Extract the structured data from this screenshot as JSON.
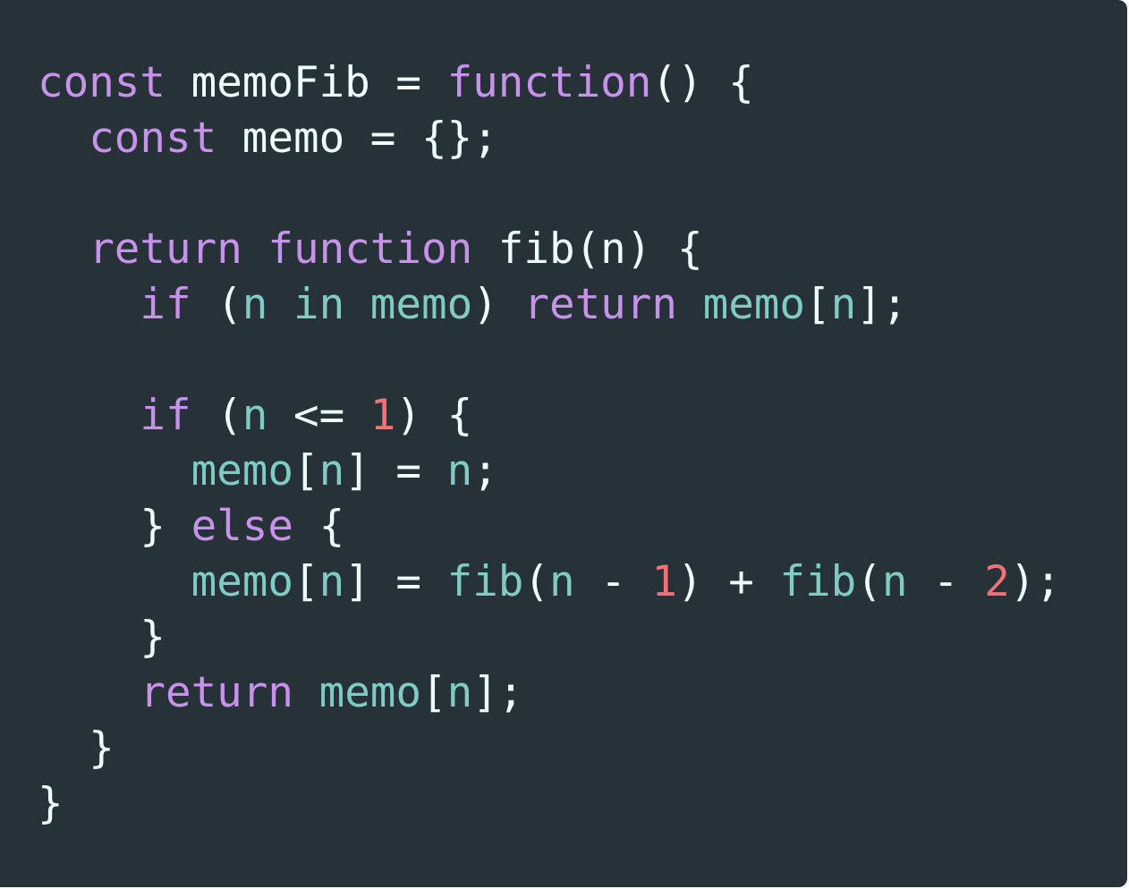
{
  "colors": {
    "background": "#263238",
    "keyword": "#c792ea",
    "identifier": "#80cbc4",
    "number": "#f07178",
    "plain": "#eeffff"
  },
  "code_lines": [
    [
      {
        "text": "const",
        "kind": "keyword"
      },
      {
        "text": " memoFib = ",
        "kind": "plain"
      },
      {
        "text": "function",
        "kind": "keyword"
      },
      {
        "text": "() {",
        "kind": "plain"
      }
    ],
    [
      {
        "text": "  ",
        "kind": "plain"
      },
      {
        "text": "const",
        "kind": "keyword"
      },
      {
        "text": " memo = {};",
        "kind": "plain"
      }
    ],
    [],
    [
      {
        "text": "  ",
        "kind": "plain"
      },
      {
        "text": "return",
        "kind": "keyword"
      },
      {
        "text": " ",
        "kind": "plain"
      },
      {
        "text": "function",
        "kind": "keyword"
      },
      {
        "text": " fib(n) {",
        "kind": "plain"
      }
    ],
    [
      {
        "text": "    ",
        "kind": "plain"
      },
      {
        "text": "if",
        "kind": "keyword"
      },
      {
        "text": " (",
        "kind": "plain"
      },
      {
        "text": "n in memo",
        "kind": "identifier"
      },
      {
        "text": ") ",
        "kind": "plain"
      },
      {
        "text": "return",
        "kind": "keyword"
      },
      {
        "text": " ",
        "kind": "plain"
      },
      {
        "text": "memo",
        "kind": "identifier"
      },
      {
        "text": "[",
        "kind": "plain"
      },
      {
        "text": "n",
        "kind": "identifier"
      },
      {
        "text": "];",
        "kind": "plain"
      }
    ],
    [],
    [
      {
        "text": "    ",
        "kind": "plain"
      },
      {
        "text": "if",
        "kind": "keyword"
      },
      {
        "text": " (",
        "kind": "plain"
      },
      {
        "text": "n",
        "kind": "identifier"
      },
      {
        "text": " <= ",
        "kind": "plain"
      },
      {
        "text": "1",
        "kind": "number"
      },
      {
        "text": ") {",
        "kind": "plain"
      }
    ],
    [
      {
        "text": "      ",
        "kind": "plain"
      },
      {
        "text": "memo",
        "kind": "identifier"
      },
      {
        "text": "[",
        "kind": "plain"
      },
      {
        "text": "n",
        "kind": "identifier"
      },
      {
        "text": "] = ",
        "kind": "plain"
      },
      {
        "text": "n",
        "kind": "identifier"
      },
      {
        "text": ";",
        "kind": "plain"
      }
    ],
    [
      {
        "text": "    } ",
        "kind": "plain"
      },
      {
        "text": "else",
        "kind": "keyword"
      },
      {
        "text": " {",
        "kind": "plain"
      }
    ],
    [
      {
        "text": "      ",
        "kind": "plain"
      },
      {
        "text": "memo",
        "kind": "identifier"
      },
      {
        "text": "[",
        "kind": "plain"
      },
      {
        "text": "n",
        "kind": "identifier"
      },
      {
        "text": "] = ",
        "kind": "plain"
      },
      {
        "text": "fib",
        "kind": "identifier"
      },
      {
        "text": "(",
        "kind": "plain"
      },
      {
        "text": "n",
        "kind": "identifier"
      },
      {
        "text": " - ",
        "kind": "plain"
      },
      {
        "text": "1",
        "kind": "number"
      },
      {
        "text": ") + ",
        "kind": "plain"
      },
      {
        "text": "fib",
        "kind": "identifier"
      },
      {
        "text": "(",
        "kind": "plain"
      },
      {
        "text": "n",
        "kind": "identifier"
      },
      {
        "text": " - ",
        "kind": "plain"
      },
      {
        "text": "2",
        "kind": "number"
      },
      {
        "text": ");",
        "kind": "plain"
      }
    ],
    [
      {
        "text": "    }",
        "kind": "plain"
      }
    ],
    [
      {
        "text": "    ",
        "kind": "plain"
      },
      {
        "text": "return",
        "kind": "keyword"
      },
      {
        "text": " ",
        "kind": "plain"
      },
      {
        "text": "memo",
        "kind": "identifier"
      },
      {
        "text": "[",
        "kind": "plain"
      },
      {
        "text": "n",
        "kind": "identifier"
      },
      {
        "text": "];",
        "kind": "plain"
      }
    ],
    [
      {
        "text": "  }",
        "kind": "plain"
      }
    ],
    [
      {
        "text": "}",
        "kind": "plain"
      }
    ]
  ]
}
